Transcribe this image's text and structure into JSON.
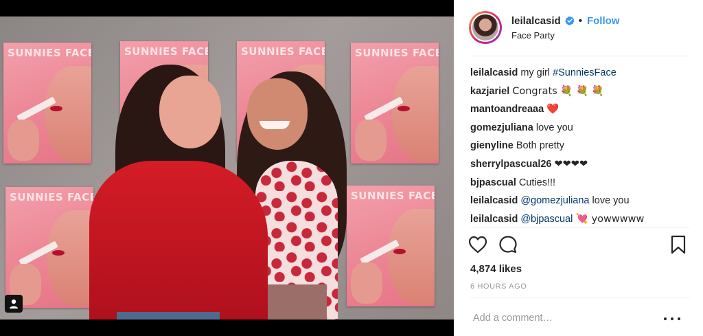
{
  "post": {
    "username": "leilalcasid",
    "follow_label": "Follow",
    "location": "Face Party",
    "poster_text": "SUNNIES FACE",
    "likes": "4,874 likes",
    "time": "6 HOURS AGO",
    "add_comment_placeholder": "Add a comment…"
  },
  "comments": [
    {
      "user": "leilalcasid",
      "text": "my girl ",
      "link": "#SunniesFace",
      "after": ""
    },
    {
      "user": "kazjariel",
      "text": "Congrats 💐 💐 💐",
      "link": "",
      "after": ""
    },
    {
      "user": "mantoandreaaa",
      "text": "❤️",
      "link": "",
      "after": ""
    },
    {
      "user": "gomezjuliana",
      "text": "love you",
      "link": "",
      "after": ""
    },
    {
      "user": "gienyline",
      "text": "Both pretty",
      "link": "",
      "after": ""
    },
    {
      "user": "sherrylpascual26",
      "text": "❤❤❤❤",
      "link": "",
      "after": ""
    },
    {
      "user": "bjpascual",
      "text": "Cuties!!!",
      "link": "",
      "after": ""
    },
    {
      "user": "leilalcasid",
      "text": "",
      "link": "@gomezjuliana",
      "after": " love you"
    },
    {
      "user": "leilalcasid",
      "text": "",
      "link": "@bjpascual",
      "after": " 💘  yowwwww"
    }
  ],
  "icons": {
    "verified": "verified-badge-icon",
    "like": "heart-icon",
    "comment": "comment-bubble-icon",
    "save": "bookmark-icon",
    "more": "more-options-icon",
    "user_tag": "user-tag-icon"
  },
  "colors": {
    "accent": "#3897f0",
    "link": "#003569",
    "muted": "#999999",
    "text": "#262626",
    "poster_pink": "#ec8594",
    "jacket_red": "#d41c26"
  }
}
